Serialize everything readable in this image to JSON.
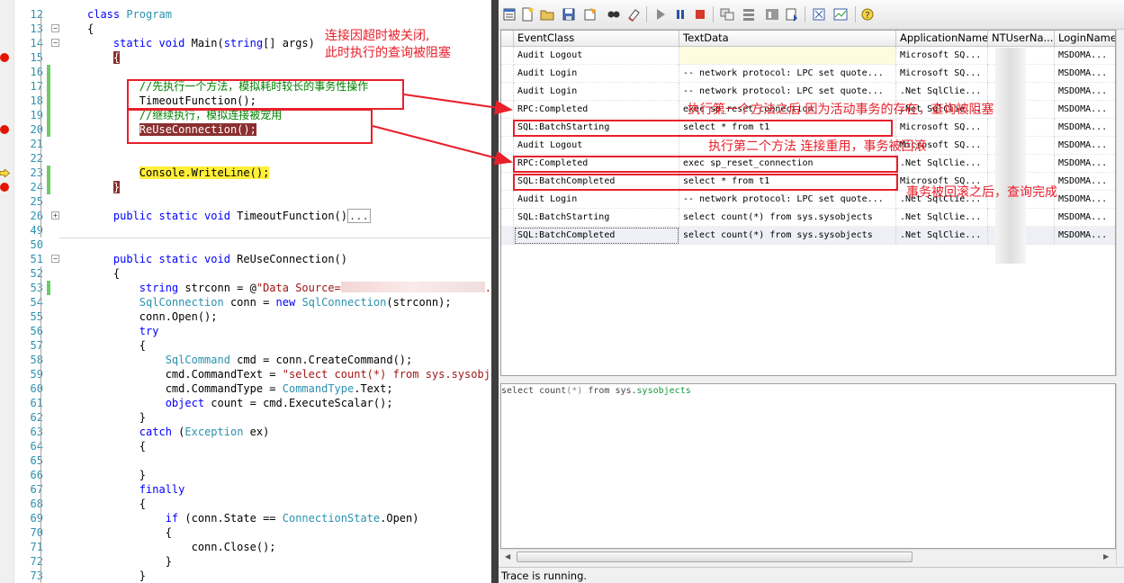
{
  "editor": {
    "lines": [
      {
        "n": "12",
        "tokens": [
          [
            "kw",
            "class "
          ],
          [
            "ty",
            "Program"
          ]
        ]
      },
      {
        "n": "13",
        "tokens": [
          [
            "t",
            "{"
          ]
        ]
      },
      {
        "n": "14",
        "tokens": [
          [
            "kw",
            "    static void "
          ],
          [
            "t",
            "Main("
          ],
          [
            "kw",
            "string"
          ],
          [
            "t",
            "[] args)"
          ]
        ]
      },
      {
        "n": "15",
        "tokens": [
          [
            "hl",
            "    {"
          ]
        ]
      },
      {
        "n": "16",
        "tokens": []
      },
      {
        "n": "17",
        "tokens": [
          [
            "cm",
            "        //先执行一个方法，模拟耗时较长的事务性操作"
          ]
        ]
      },
      {
        "n": "18",
        "tokens": [
          [
            "t",
            "        TimeoutFunction();"
          ]
        ]
      },
      {
        "n": "19",
        "tokens": [
          [
            "cm",
            "        //继续执行，模拟连接被宠用"
          ]
        ]
      },
      {
        "n": "20",
        "tokens": [
          [
            "hl",
            "        ReUseConnection();"
          ]
        ]
      },
      {
        "n": "21",
        "tokens": []
      },
      {
        "n": "22",
        "tokens": []
      },
      {
        "n": "23",
        "tokens": [
          [
            "hly",
            "        Console.WriteLine();"
          ]
        ]
      },
      {
        "n": "24",
        "tokens": [
          [
            "hl",
            "    }"
          ]
        ]
      },
      {
        "n": "25",
        "tokens": []
      },
      {
        "n": "26",
        "tokens": [
          [
            "kw",
            "    public static void "
          ],
          [
            "t",
            "TimeoutFunction()"
          ],
          [
            "col",
            "..."
          ]
        ]
      },
      {
        "n": "49",
        "tokens": []
      },
      {
        "n": "50",
        "tokens": []
      },
      {
        "n": "51",
        "tokens": [
          [
            "kw",
            "    public static void "
          ],
          [
            "t",
            "ReUseConnection()"
          ]
        ]
      },
      {
        "n": "52",
        "tokens": [
          [
            "t",
            "    {"
          ]
        ]
      },
      {
        "n": "53",
        "tokens": [
          [
            "kw",
            "        string "
          ],
          [
            "t",
            "strconn = @"
          ],
          [
            "str",
            "\"Data Source="
          ],
          [
            "blur",
            ""
          ],
          [
            "str",
            ".po"
          ]
        ]
      },
      {
        "n": "54",
        "tokens": [
          [
            "ty",
            "        SqlConnection "
          ],
          [
            "t",
            "conn = "
          ],
          [
            "kw",
            "new "
          ],
          [
            "ty",
            "SqlConnection"
          ],
          [
            "t",
            "(strconn);"
          ]
        ]
      },
      {
        "n": "55",
        "tokens": [
          [
            "t",
            "        conn.Open();"
          ]
        ]
      },
      {
        "n": "56",
        "tokens": [
          [
            "kw",
            "        try"
          ]
        ]
      },
      {
        "n": "57",
        "tokens": [
          [
            "t",
            "        {"
          ]
        ]
      },
      {
        "n": "58",
        "tokens": [
          [
            "ty",
            "            SqlCommand "
          ],
          [
            "t",
            "cmd = conn.CreateCommand();"
          ]
        ]
      },
      {
        "n": "59",
        "tokens": [
          [
            "t",
            "            cmd.CommandText = "
          ],
          [
            "str",
            "\"select count(*) from sys.sysobjec"
          ]
        ]
      },
      {
        "n": "60",
        "tokens": [
          [
            "t",
            "            cmd.CommandType = "
          ],
          [
            "ty",
            "CommandType"
          ],
          [
            "t",
            ".Text;"
          ]
        ]
      },
      {
        "n": "61",
        "tokens": [
          [
            "kw",
            "            object "
          ],
          [
            "t",
            "count = cmd.ExecuteScalar();"
          ]
        ]
      },
      {
        "n": "62",
        "tokens": [
          [
            "t",
            "        }"
          ]
        ]
      },
      {
        "n": "63",
        "tokens": [
          [
            "kw",
            "        catch "
          ],
          [
            "t",
            "("
          ],
          [
            "ty",
            "Exception "
          ],
          [
            "t",
            "ex)"
          ]
        ]
      },
      {
        "n": "64",
        "tokens": [
          [
            "t",
            "        {"
          ]
        ]
      },
      {
        "n": "65",
        "tokens": []
      },
      {
        "n": "66",
        "tokens": [
          [
            "t",
            "        }"
          ]
        ]
      },
      {
        "n": "67",
        "tokens": [
          [
            "kw",
            "        finally"
          ]
        ]
      },
      {
        "n": "68",
        "tokens": [
          [
            "t",
            "        {"
          ]
        ]
      },
      {
        "n": "69",
        "tokens": [
          [
            "kw",
            "            if "
          ],
          [
            "t",
            "(conn.State == "
          ],
          [
            "ty",
            "ConnectionState"
          ],
          [
            "t",
            ".Open)"
          ]
        ]
      },
      {
        "n": "70",
        "tokens": [
          [
            "t",
            "            {"
          ]
        ]
      },
      {
        "n": "71",
        "tokens": [
          [
            "t",
            "                conn.Close();"
          ]
        ]
      },
      {
        "n": "72",
        "tokens": [
          [
            "t",
            "            }"
          ]
        ]
      },
      {
        "n": "73",
        "tokens": [
          [
            "t",
            "        }"
          ]
        ]
      }
    ]
  },
  "toolbar": {
    "icons": [
      "trace-properties-icon",
      "new-trace-icon",
      "open-icon",
      "save-icon",
      "template-icon",
      "find-icon",
      "clear-icon",
      "start-icon",
      "pause-icon",
      "stop-icon",
      "events-icon",
      "columns-icon",
      "filter-icon",
      "autoscroll-icon",
      "sql-icon",
      "perfmon-icon",
      "help-icon"
    ]
  },
  "grid": {
    "columns": [
      "EventClass",
      "TextData",
      "ApplicationName",
      "NTUserNa...",
      "LoginName"
    ],
    "rows": [
      {
        "event": "Audit Logout",
        "text": "",
        "app": "Microsoft SQ...",
        "login": "MSDOMA..."
      },
      {
        "event": "Audit Login",
        "text": "-- network protocol: LPC  set quote...",
        "app": "Microsoft SQ...",
        "login": "MSDOMA..."
      },
      {
        "event": "Audit Login",
        "text": "-- network protocol: LPC  set quote...",
        "app": ".Net SqlClie...",
        "login": "MSDOMA..."
      },
      {
        "event": "RPC:Completed",
        "text": "exec sp_reset_connection",
        "app": ".Net SqlClie...",
        "login": "MSDOMA..."
      },
      {
        "event": "SQL:BatchStarting",
        "text": "select * from t1",
        "app": "Microsoft SQ...",
        "login": "MSDOMA..."
      },
      {
        "event": "Audit Logout",
        "text": "",
        "app": "Microsoft SQ...",
        "login": "MSDOMA..."
      },
      {
        "event": "RPC:Completed",
        "text": "exec sp_reset_connection",
        "app": ".Net SqlClie...",
        "login": "MSDOMA..."
      },
      {
        "event": "SQL:BatchCompleted",
        "text": "select * from t1",
        "app": "Microsoft SQ...",
        "login": "MSDOMA..."
      },
      {
        "event": "Audit Login",
        "text": "-- network protocol: LPC  set quote...",
        "app": ".Net SqlClie...",
        "login": "MSDOMA..."
      },
      {
        "event": "SQL:BatchStarting",
        "text": "select count(*) from sys.sysobjects",
        "app": ".Net SqlClie...",
        "login": "MSDOMA..."
      },
      {
        "event": "SQL:BatchCompleted",
        "text": "select count(*) from sys.sysobjects",
        "app": ".Net SqlClie...",
        "login": "MSDOMA..."
      }
    ]
  },
  "detail": {
    "kw1": "select",
    "mid1": " count",
    "paren": "(*)",
    "kw2": " from",
    "mid2": " sys.",
    "obj": "sysobjects"
  },
  "status": "Trace is running.",
  "annotations": {
    "a1": "连接因超时被关闭,\n此时执行的查询被阻塞",
    "a2": "执行第一个方法之后 因为活动事务的存在，查询被阻塞",
    "a3": "执行第二个方法 连接重用，事务被回滚",
    "a4": "事务被回滚之后，查询完成",
    "color": "#e8202a"
  },
  "colors": {
    "keyword": "#0000ff",
    "type": "#2b91af",
    "string": "#a31515",
    "comment": "#008000",
    "breakpoint": "#e51400"
  }
}
